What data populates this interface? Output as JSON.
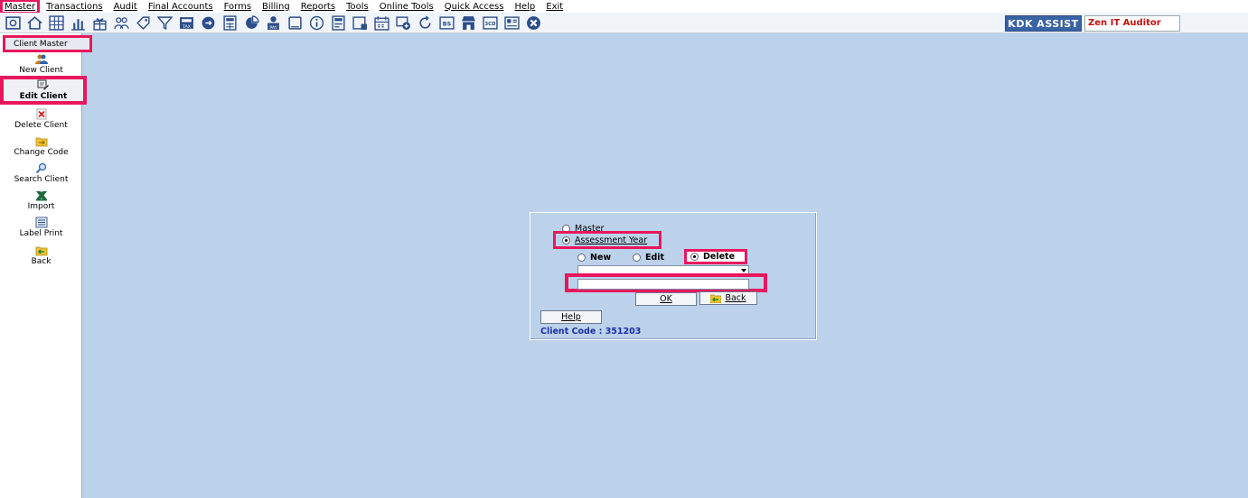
{
  "menubar": {
    "items": [
      "Master",
      "Transactions",
      "Audit",
      "Final Accounts",
      "Forms",
      "Billing",
      "Reports",
      "Tools",
      "Online Tools",
      "Quick Access",
      "Help",
      "Exit"
    ]
  },
  "toolbar": {
    "icons": [
      "capture-icon",
      "home-icon",
      "calculator-grid-icon",
      "bar-chart-icon",
      "gift-icon",
      "users-group-icon",
      "tag-icon",
      "filter-icon",
      "tax-icon",
      "toggle-icon",
      "calendar-grid-icon",
      "pie-icon",
      "pay-icon",
      "document-icon",
      "info-icon",
      "report-icon",
      "chart-window-icon",
      "schedule-icon",
      "export-icon",
      "refresh-icon",
      "bs-icon",
      "store-icon",
      "3cd-icon",
      "form-icon",
      "close-circle-icon"
    ],
    "kdk_label": "KDK ASSIST",
    "auditor_label": "Zen IT Auditor"
  },
  "sidebar": {
    "header": "Client Master",
    "items": [
      {
        "label": "New Client",
        "icon": "new-client-icon"
      },
      {
        "label": "Edit Client",
        "icon": "edit-client-icon"
      },
      {
        "label": "Delete Client",
        "icon": "delete-client-icon"
      },
      {
        "label": "Change Code",
        "icon": "change-code-icon"
      },
      {
        "label": "Search Client",
        "icon": "search-client-icon"
      },
      {
        "label": "Import",
        "icon": "import-excel-icon"
      },
      {
        "label": "Label Print",
        "icon": "label-print-icon"
      },
      {
        "label": "Back",
        "icon": "back-icon"
      }
    ],
    "selected": "Edit Client"
  },
  "dialog": {
    "radio_master": "Master",
    "radio_assessment_year": "Assessment Year",
    "radio_new": "New",
    "radio_edit": "Edit",
    "radio_delete": "Delete",
    "combo_value": "",
    "text_value": "",
    "ok_label": "OK",
    "back_label": "Back",
    "help_label": "Help",
    "client_code": "Client Code : 351203"
  },
  "colors": {
    "background": "#bcd2ea",
    "highlight": "#e8175d",
    "kdk_button": "#3a63a5",
    "client_code_text": "#1a2fa8",
    "auditor_text": "#c41010"
  }
}
